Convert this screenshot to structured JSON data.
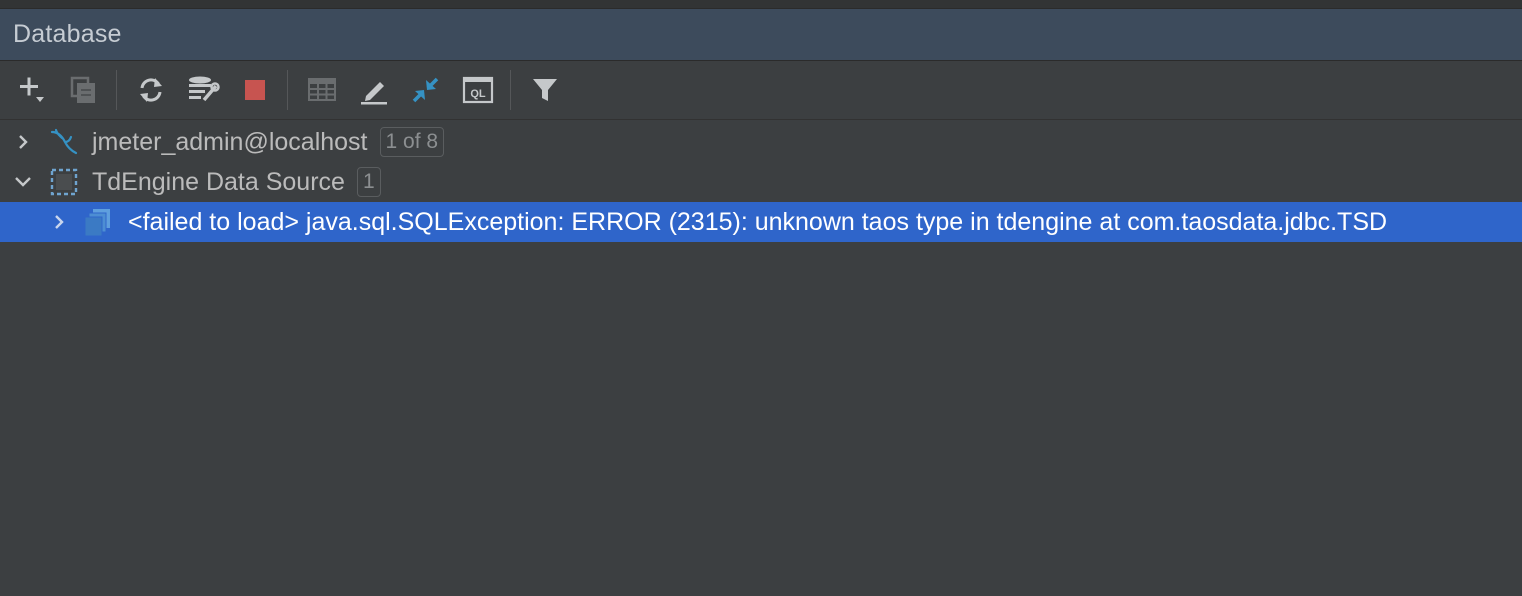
{
  "panel": {
    "title": "Database"
  },
  "toolbar": {
    "buttons": [
      {
        "name": "add-button",
        "icon": "plus-dropdown-icon"
      },
      {
        "name": "duplicate-button",
        "icon": "copy-icon"
      },
      {
        "name": "refresh-button",
        "icon": "refresh-icon"
      },
      {
        "name": "data-source-properties-button",
        "icon": "db-wrench-icon"
      },
      {
        "name": "stop-button",
        "icon": "stop-icon"
      },
      {
        "name": "table-view-button",
        "icon": "table-icon"
      },
      {
        "name": "edit-button",
        "icon": "pencil-icon"
      },
      {
        "name": "jump-to-source-button",
        "icon": "collapse-arrows-icon"
      },
      {
        "name": "ql-console-button",
        "icon": "ql-console-icon"
      },
      {
        "name": "filter-button",
        "icon": "filter-icon"
      }
    ],
    "colors": {
      "stop": "#c75450",
      "accent": "#3592c4"
    }
  },
  "tree": {
    "items": [
      {
        "label": "jmeter_admin@localhost",
        "badge": "1 of 8",
        "expanded": false,
        "icon": "mysql-dolphin-icon"
      },
      {
        "label": "TdEngine Data Source",
        "badge": "1",
        "expanded": true,
        "icon": "data-source-icon"
      },
      {
        "label": "<failed to load> java.sql.SQLException: ERROR (2315): unknown taos type in tdengine  at com.taosdata.jdbc.TSD",
        "expanded": false,
        "selected": true,
        "icon": "schema-stack-icon"
      }
    ]
  },
  "colors": {
    "selection": "#2f65ca",
    "header_bg": "#3d4b5c",
    "panel_bg": "#3c3f41"
  }
}
